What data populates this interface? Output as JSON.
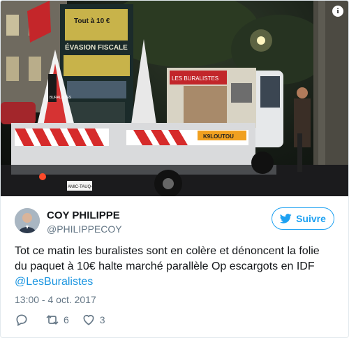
{
  "photo": {
    "sign_top": "Tout à 10 €",
    "sign_banner": "ÉVASION FISCALE",
    "rear_sign": "BURALISTES",
    "cab_banner": "LES BURALISTES",
    "truck_plate": "AMIC-TAUQ-",
    "truck_label": "K9LOUTOU",
    "info_icon": "info-icon"
  },
  "tweet": {
    "author_name": "COY PHILIPPE",
    "author_handle": "@PHILIPPECOY",
    "follow_label": "Suivre",
    "text_line1": "Tot ce matin les buralistes sont en colère et dénoncent la folie",
    "text_line2": "du paquet à 10€ halte marché parallèle Op escargots en IDF",
    "mention": "@LesBuralistes",
    "timestamp": "13:00 - 4 oct. 2017",
    "reply_count": "",
    "retweet_count": "6",
    "like_count": "3"
  },
  "colors": {
    "accent": "#1da1f2",
    "muted": "#657786",
    "text": "#14171a"
  }
}
